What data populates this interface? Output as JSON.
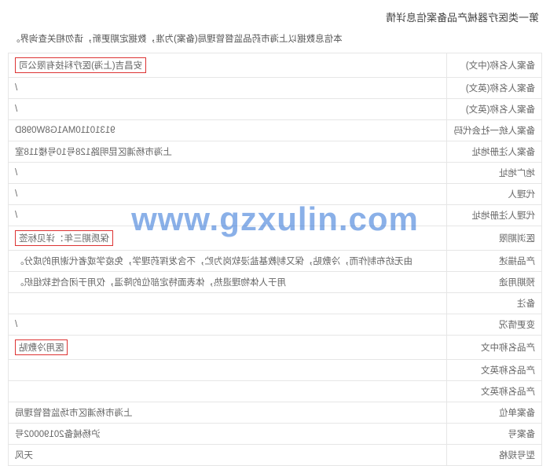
{
  "title": "第一类医疗器械产品备案信息详情",
  "subtitle": "本信息数据以上海市药品监督管理局(备案)为准，数据定期更新，请勿相关查询界。",
  "watermark": "www.gzxulin.com",
  "rows": [
    {
      "label": "备案人名称(中文)",
      "value": "安昌吉(上海)医疗科技有限公司",
      "red": true
    },
    {
      "label": "备案人名称(英文)",
      "value": "/"
    },
    {
      "label": "备案人名称(英文)",
      "value": "/"
    },
    {
      "label": "备案人统一社会代码",
      "value": "91310110MA1G8W098D"
    },
    {
      "label": "备案人注册地址",
      "value": "上海市杨浦区昆明路128号10号楼118室"
    },
    {
      "label": "地广地址",
      "value": "/"
    },
    {
      "label": "代理人",
      "value": "/"
    },
    {
      "label": "代理人注册地址",
      "value": "/"
    },
    {
      "label": "医浏期限",
      "value": "保质期三年：详见标签",
      "red": true
    },
    {
      "label": "产品描述",
      "value": "由无纺布制作而，冷敷贴，保又制教基盐浸软岗为贮，不含发挥药理学，免疫学或者代谢用的成分。"
    },
    {
      "label": "预期用途",
      "value": "用于人体物理退热，体表面特定部位的降温，仅用于闭合性软组织。"
    },
    {
      "label": "备注",
      "value": ""
    },
    {
      "label": "变更情况",
      "value": "/"
    },
    {
      "label": "产品名称中文",
      "value": "医用冷敷贴",
      "red": true
    },
    {
      "label": "产品名称英文",
      "value": ""
    },
    {
      "label": "产品名称英文",
      "value": ""
    },
    {
      "label": "备案单位",
      "value": "上海市杨浦区市场监督管理局"
    },
    {
      "label": "备案号",
      "value": "沪杨械备20190002号"
    },
    {
      "label": "型号规格",
      "value": "天风"
    }
  ]
}
